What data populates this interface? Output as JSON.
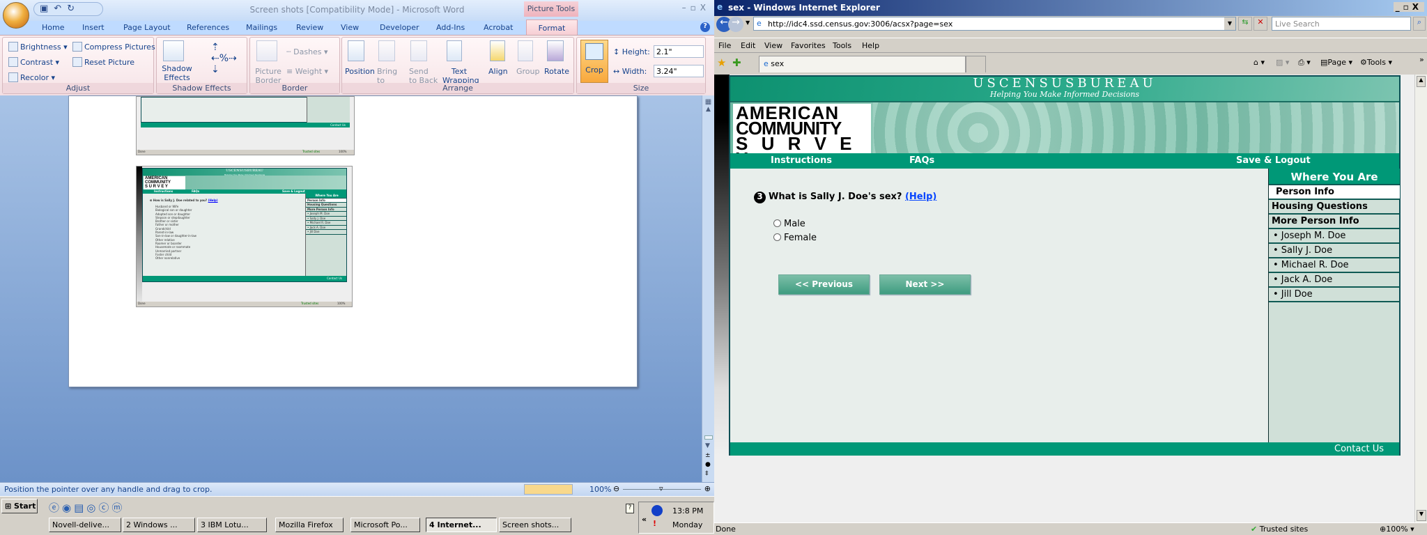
{
  "word": {
    "title": "Screen shots [Compatibility Mode] - Microsoft Word",
    "context_tab": "Picture Tools",
    "tabs": [
      "Home",
      "Insert",
      "Page Layout",
      "References",
      "Mailings",
      "Review",
      "View",
      "Developer",
      "Add-Ins",
      "Acrobat"
    ],
    "active_tab": "Format",
    "ribbon": {
      "adjust": {
        "label": "Adjust",
        "brightness": "Brightness",
        "contrast": "Contrast",
        "recolor": "Recolor",
        "compress": "Compress Pictures",
        "reset": "Reset Picture"
      },
      "shadow": {
        "label": "Shadow Effects",
        "button": "Shadow Effects"
      },
      "border": {
        "label": "Border",
        "picture_border": "Picture Border",
        "dashes": "Dashes",
        "weight": "Weight"
      },
      "arrange": {
        "label": "Arrange",
        "position": "Position",
        "bring": "Bring to Front",
        "send": "Send to Back",
        "wrap": "Text Wrapping",
        "align": "Align",
        "group": "Group",
        "rotate": "Rotate"
      },
      "size": {
        "label": "Size",
        "crop": "Crop",
        "height_label": "Height:",
        "height": "2.1\"",
        "width_label": "Width:",
        "width": "3.24\""
      }
    },
    "status": "Position the pointer over any handle and drag to crop.",
    "zoom": "100%",
    "thumb1": {
      "contact": "Contact Us",
      "status": "Done",
      "trusted": "Trusted sites",
      "zoom": "100%"
    },
    "thumb2": {
      "bureau": "USCENSUSBUREAU",
      "tagline": "Helping You Make Informed Decisions",
      "logo": [
        "AMERICAN",
        "COMMUNITY",
        "S U R V E Y"
      ],
      "nav": [
        "Instructions",
        "FAQs",
        "Save & Logout"
      ],
      "question": "How is Sally J. Doe related to you?",
      "help": "(Help)",
      "options": [
        "Husband or Wife",
        "Biological son or daughter",
        "Adopted son or daughter",
        "Stepson or stepdaughter",
        "Brother or sister",
        "Father or mother",
        "Grandchild",
        "Parent-in-law",
        "Son-in-law or daughter-in-law",
        "Other relative",
        "Roomer or boarder",
        "Housemate or roommate",
        "Unmarried partner",
        "Foster child",
        "Other nonrelative"
      ],
      "side": [
        "Where You Are",
        "Person Info",
        "Housing Questions",
        "More Person Info",
        "• Joseph M. Doe",
        "• Sally J. Doe",
        "• Michael R. Doe",
        "• Jack A. Doe",
        "• Jill Doe"
      ],
      "contact": "Contact Us",
      "status": "Done",
      "trusted": "Trusted sites",
      "zoom": "100%"
    }
  },
  "taskbar": {
    "start": "Start",
    "buttons": [
      "Novell-delive...",
      "2 Windows ...",
      "3 IBM Lotu...",
      "Mozilla Firefox",
      "Microsoft Po...",
      "4 Internet...",
      "Screen shots..."
    ],
    "time": "13:8 PM",
    "day": "Monday"
  },
  "ie": {
    "title": "sex - Windows Internet Explorer",
    "url": "http://idc4.ssd.census.gov:3006/acsx?page=sex",
    "search_placeholder": "Live Search",
    "menu": [
      "File",
      "Edit",
      "View",
      "Favorites",
      "Tools",
      "Help"
    ],
    "tab": "sex",
    "cmd": {
      "page": "Page",
      "tools": "Tools"
    },
    "status": "Done",
    "zone": "Trusted sites",
    "zoom": "100%"
  },
  "census": {
    "bureau": "USCENSUSBUREAU",
    "tagline": "Helping You Make Informed Decisions",
    "logo": [
      "AMERICAN",
      "COMMUNITY",
      "S U R V E Y"
    ],
    "nav": {
      "instructions": "Instructions",
      "faqs": "FAQs",
      "logout": "Save & Logout"
    },
    "question_number": "3",
    "question": "What is Sally J. Doe's sex?",
    "help": "(Help)",
    "options": [
      "Male",
      "Female"
    ],
    "previous": "<<   Previous",
    "next": "Next   >>",
    "sidebar": {
      "title": "Where You Are",
      "items": [
        "Person Info",
        "Housing Questions",
        "More Person Info",
        "• Joseph M. Doe",
        "• Sally J. Doe",
        "• Michael R. Doe",
        "• Jack A. Doe",
        "• Jill Doe"
      ]
    },
    "contact": "Contact Us"
  }
}
